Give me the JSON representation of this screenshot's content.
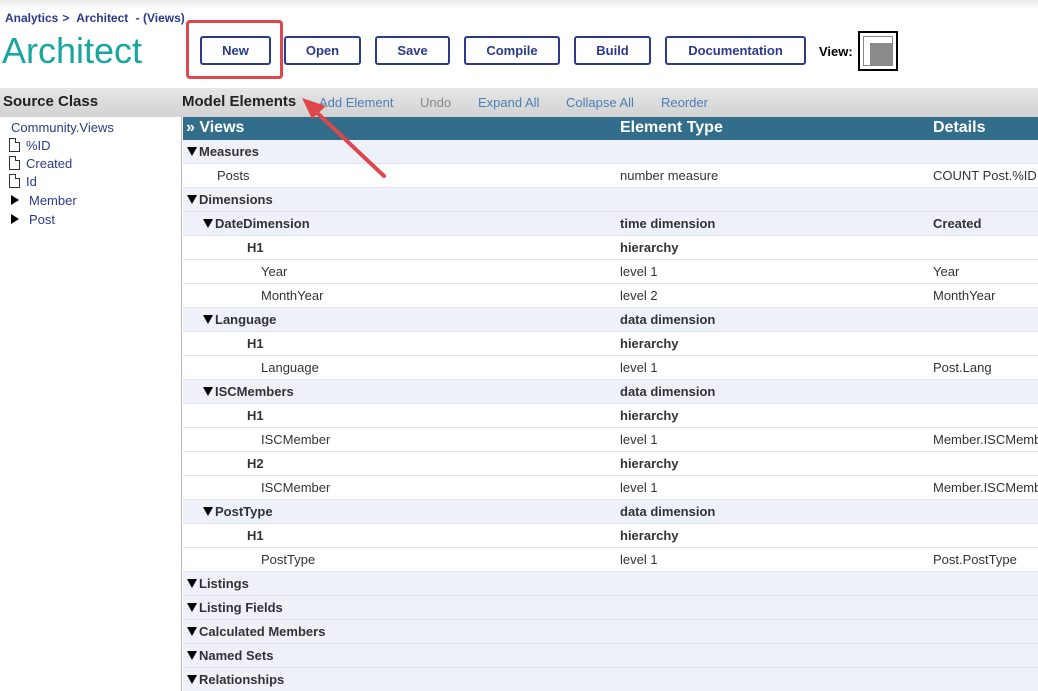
{
  "breadcrumb": {
    "part1": "Analytics",
    "sep": ">",
    "part2": "Architect",
    "part3": "- (Views)"
  },
  "app_title": "Architect",
  "toolbar": {
    "new_label": "New",
    "open_label": "Open",
    "save_label": "Save",
    "compile_label": "Compile",
    "build_label": "Build",
    "documentation_label": "Documentation",
    "view_label": "View:"
  },
  "source": {
    "title": "Source Class",
    "root": "Community.Views",
    "items": [
      "%ID",
      "Created",
      "Id",
      "Member",
      "Post"
    ]
  },
  "model": {
    "title": "Model Elements",
    "links": {
      "add_element": "Add Element",
      "undo": "Undo",
      "expand_all": "Expand All",
      "collapse_all": "Collapse All",
      "reorder": "Reorder"
    },
    "columns": {
      "name": "» Views",
      "type": "Element Type",
      "details": "Details"
    },
    "rows": [
      {
        "name": "Measures",
        "type": "",
        "details": ""
      },
      {
        "name": "Posts",
        "type": "number measure",
        "details": "COUNT Post.%ID"
      },
      {
        "name": "Dimensions",
        "type": "",
        "details": ""
      },
      {
        "name": "DateDimension",
        "type": "time dimension",
        "details": "Created"
      },
      {
        "name": "H1",
        "type": "hierarchy",
        "details": ""
      },
      {
        "name": "Year",
        "type": "level 1",
        "details": "Year"
      },
      {
        "name": "MonthYear",
        "type": "level 2",
        "details": "MonthYear"
      },
      {
        "name": "Language",
        "type": "data dimension",
        "details": ""
      },
      {
        "name": "H1",
        "type": "hierarchy",
        "details": ""
      },
      {
        "name": "Language",
        "type": "level 1",
        "details": "Post.Lang"
      },
      {
        "name": "ISCMembers",
        "type": "data dimension",
        "details": ""
      },
      {
        "name": "H1",
        "type": "hierarchy",
        "details": ""
      },
      {
        "name": "ISCMember",
        "type": "level 1",
        "details": "Member.ISCMemb"
      },
      {
        "name": "H2",
        "type": "hierarchy",
        "details": ""
      },
      {
        "name": "ISCMember",
        "type": "level 1",
        "details": "Member.ISCMemb"
      },
      {
        "name": "PostType",
        "type": "data dimension",
        "details": ""
      },
      {
        "name": "H1",
        "type": "hierarchy",
        "details": ""
      },
      {
        "name": "PostType",
        "type": "level 1",
        "details": "Post.PostType"
      },
      {
        "name": "Listings",
        "type": "",
        "details": ""
      },
      {
        "name": "Listing Fields",
        "type": "",
        "details": ""
      },
      {
        "name": "Calculated Members",
        "type": "",
        "details": ""
      },
      {
        "name": "Named Sets",
        "type": "",
        "details": ""
      },
      {
        "name": "Relationships",
        "type": "",
        "details": ""
      }
    ]
  },
  "colors": {
    "accent_teal": "#1aa6a0",
    "navy": "#2b3a8c",
    "header_blue": "#326d8c",
    "highlight_red": "#e0474c"
  },
  "icons": [
    "document-icon",
    "triangle-right-icon",
    "triangle-down-icon",
    "view-layout-icon",
    "arrow-annotation"
  ]
}
